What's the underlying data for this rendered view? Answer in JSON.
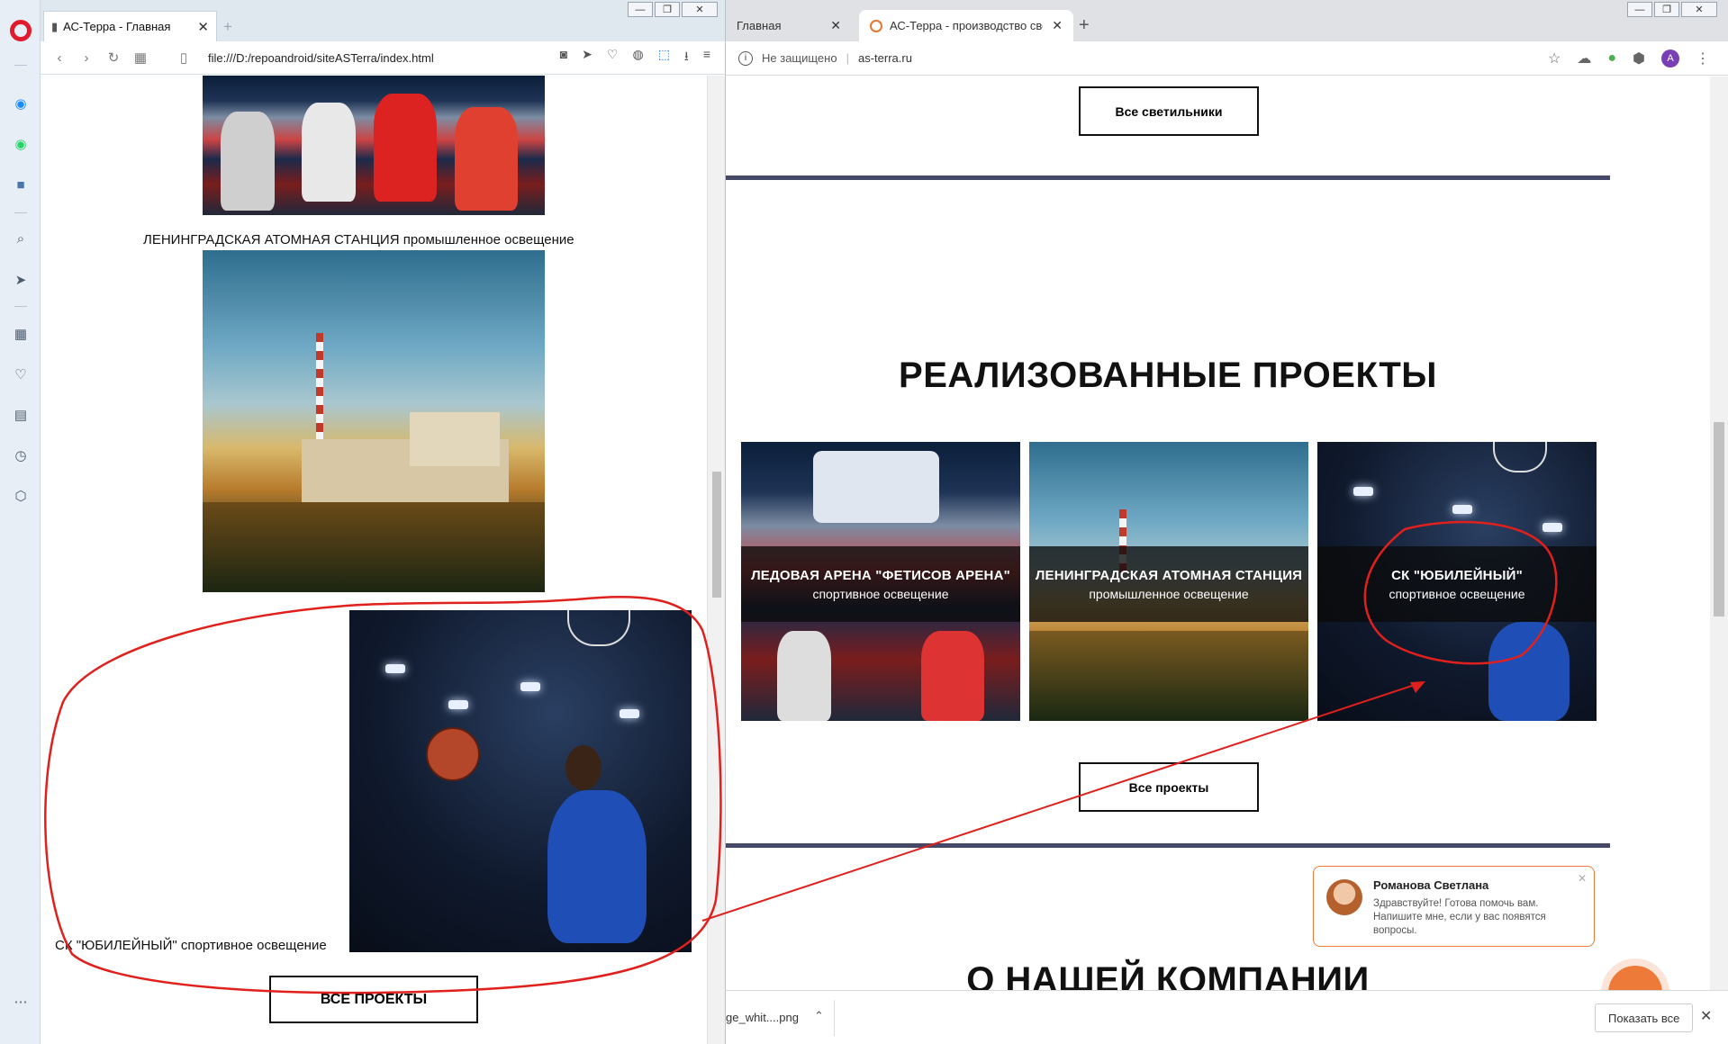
{
  "opera": {
    "tab_title": "АС-Терра - Главная",
    "tab_close": "✕",
    "new_tab": "+",
    "url": "file:///D:/repoandroid/siteASTerra/index.html",
    "more": "⋯",
    "captions": {
      "npp": "ЛЕНИНГРАДСКАЯ АТОМНАЯ СТАНЦИЯ промышленное освещение",
      "jubilee": "СК \"ЮБИЛЕЙНЫЙ\" спортивное освещение"
    },
    "all_projects_button": "ВСЕ ПРОЕКТЫ"
  },
  "chrome": {
    "tabs": [
      {
        "label": "Главная"
      },
      {
        "label": "АС-Терра - производство свето"
      }
    ],
    "tab_close": "✕",
    "new_tab": "+",
    "insecure_label": "Не защищено",
    "url_divider": "|",
    "url": "as-terra.ru",
    "avatar_letter": "A",
    "all_fixtures_button": "Все светильники",
    "section_projects_title": "РЕАЛИЗОВАННЫЕ ПРОЕКТЫ",
    "cards": [
      {
        "title": "ЛЕДОВАЯ АРЕНА \"ФЕТИСОВ АРЕНА\"",
        "subtitle": "спортивное освещение"
      },
      {
        "title": "ЛЕНИНГРАДСКАЯ АТОМНАЯ СТАНЦИЯ",
        "subtitle": "промышленное освещение"
      },
      {
        "title": "СК \"ЮБИЛЕЙНЫЙ\"",
        "subtitle": "спортивное освещение"
      }
    ],
    "all_projects_button": "Все проекты",
    "section_company_title": "О НАШЕЙ КОМПАНИИ",
    "chat": {
      "name": "Романова Светлана",
      "message": "Здравствуйте! Готова помочь вам. Напишите мне, если у вас появятся вопросы.",
      "close": "✕"
    },
    "download": {
      "file": "ge_whit....png",
      "show_all": "Показать все",
      "close": "✕"
    }
  },
  "colors": {
    "annotation": "#e0201c",
    "rule": "#454866",
    "chat_accent": "#ee7a3a",
    "opera_red": "#e01b2e"
  },
  "icons": [
    "opera-logo-icon",
    "messenger-icon",
    "whatsapp-icon",
    "vk-icon",
    "search-icon",
    "send-icon",
    "speed-dial-icon",
    "heart-icon",
    "news-icon",
    "history-icon",
    "extensions-icon",
    "back-icon",
    "forward-icon",
    "reload-icon",
    "tabs-icon",
    "page-icon",
    "camera-icon",
    "share-icon",
    "translate-icon",
    "download-icon",
    "menu-icon",
    "info-icon",
    "star-icon",
    "extension-icon",
    "chat-icon"
  ]
}
